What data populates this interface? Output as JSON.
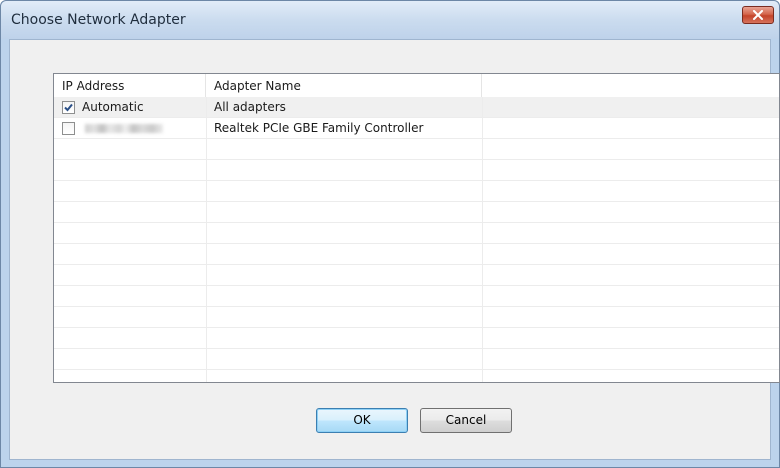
{
  "window": {
    "title": "Choose Network Adapter",
    "close_icon": "close-icon"
  },
  "table": {
    "columns": [
      "IP Address",
      "Adapter Name",
      ""
    ],
    "rows": [
      {
        "checked": true,
        "ip": "Automatic",
        "adapter": "All adapters",
        "ip_blurred": false
      },
      {
        "checked": false,
        "ip": "",
        "adapter": "Realtek PCIe GBE Family Controller",
        "ip_blurred": true
      }
    ],
    "empty_row_count": 11
  },
  "buttons": {
    "ok_label": "OK",
    "cancel_label": "Cancel"
  },
  "colors": {
    "titlebar": "#cbdcef",
    "close_button": "#c4432a",
    "default_button_border": "#3c7fb1"
  }
}
